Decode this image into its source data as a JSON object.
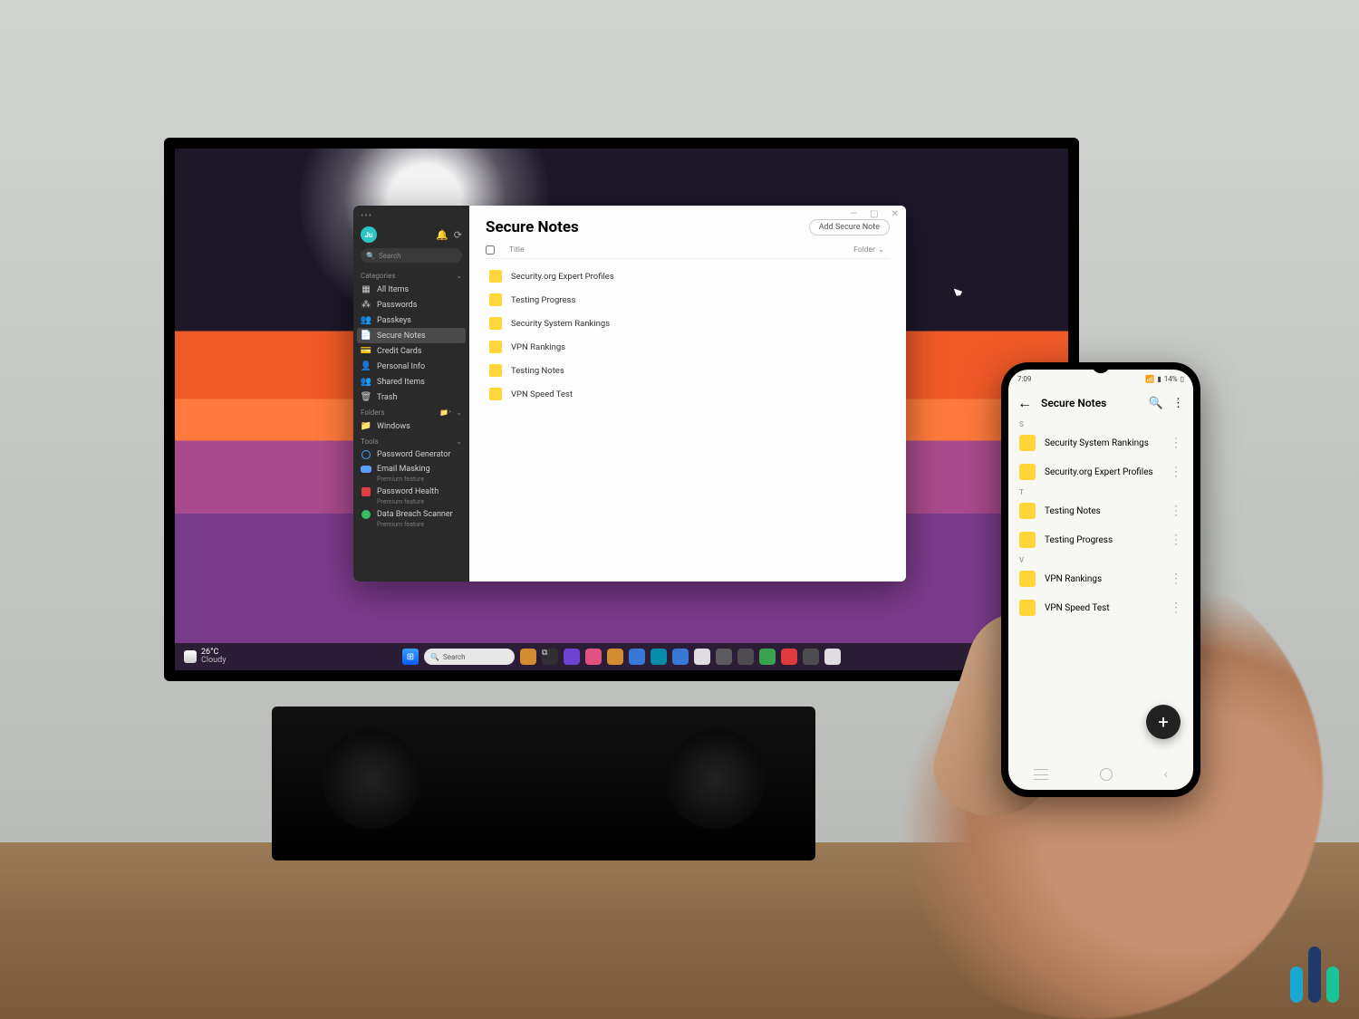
{
  "desktop": {
    "window": {
      "title": "Secure Notes",
      "add_button": "Add Secure Note",
      "columns": {
        "title": "Title",
        "folder": "Folder"
      },
      "notes": [
        "Security.org Expert Profiles",
        "Testing Progress",
        "Security System Rankings",
        "VPN Rankings",
        "Testing Notes",
        "VPN Speed Test"
      ]
    },
    "sidebar": {
      "avatar_initials": "Ju",
      "search_placeholder": "Search",
      "sections": {
        "categories_label": "Categories",
        "folders_label": "Folders",
        "tools_label": "Tools"
      },
      "categories": [
        {
          "label": "All Items",
          "icon": "grid"
        },
        {
          "label": "Passwords",
          "icon": "password"
        },
        {
          "label": "Passkeys",
          "icon": "passkey"
        },
        {
          "label": "Secure Notes",
          "icon": "note",
          "active": true
        },
        {
          "label": "Credit Cards",
          "icon": "card"
        },
        {
          "label": "Personal Info",
          "icon": "person"
        },
        {
          "label": "Shared Items",
          "icon": "shared"
        },
        {
          "label": "Trash",
          "icon": "trash"
        }
      ],
      "folders": [
        {
          "label": "Windows",
          "icon": "folder"
        }
      ],
      "tools": [
        {
          "label": "Password Generator",
          "premium": false
        },
        {
          "label": "Email Masking",
          "premium": true,
          "premium_label": "Premium feature"
        },
        {
          "label": "Password Health",
          "premium": true,
          "premium_label": "Premium feature"
        },
        {
          "label": "Data Breach Scanner",
          "premium": true,
          "premium_label": "Premium feature"
        }
      ]
    },
    "taskbar": {
      "weather_temp": "26°C",
      "weather_desc": "Cloudy",
      "search_placeholder": "Search"
    }
  },
  "phone": {
    "status_time": "7:09",
    "status_right": "14%",
    "appbar_title": "Secure Notes",
    "groups": [
      {
        "letter": "S",
        "items": [
          "Security System Rankings",
          "Security.org Expert Profiles"
        ]
      },
      {
        "letter": "T",
        "items": [
          "Testing Notes",
          "Testing Progress"
        ]
      },
      {
        "letter": "V",
        "items": [
          "VPN Rankings",
          "VPN Speed Test"
        ]
      }
    ],
    "fab_label": "+"
  }
}
